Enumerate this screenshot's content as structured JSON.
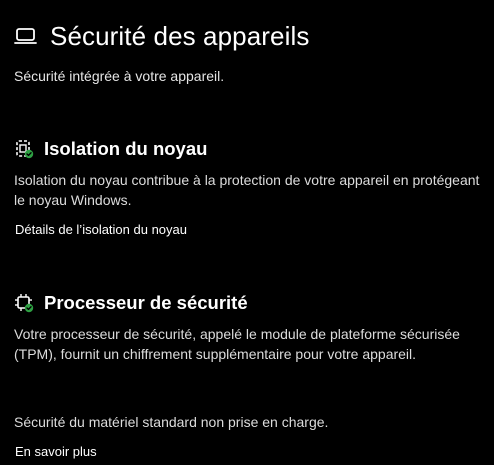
{
  "header": {
    "title": "Sécurité des appareils",
    "icon": "laptop-icon",
    "subtitle": "Sécurité intégrée à votre appareil."
  },
  "core_isolation": {
    "icon": "core-isolation-shield-icon",
    "title": "Isolation du noyau",
    "description": "Isolation du noyau contribue à la protection de votre appareil en protégeant le noyau Windows.",
    "link": "Détails de l’isolation du noyau"
  },
  "security_processor": {
    "icon": "security-chip-icon",
    "title": "Processeur de sécurité",
    "description": "Votre processeur de sécurité, appelé le module de plateforme sécurisée (TPM), fournit un chiffrement supplémentaire pour votre appareil.",
    "status": "Sécurité du matériel standard non prise en charge.",
    "link": "En savoir plus"
  },
  "colors": {
    "background": "#000000",
    "text": "#ffffff",
    "ok_green": "#2ea043"
  }
}
